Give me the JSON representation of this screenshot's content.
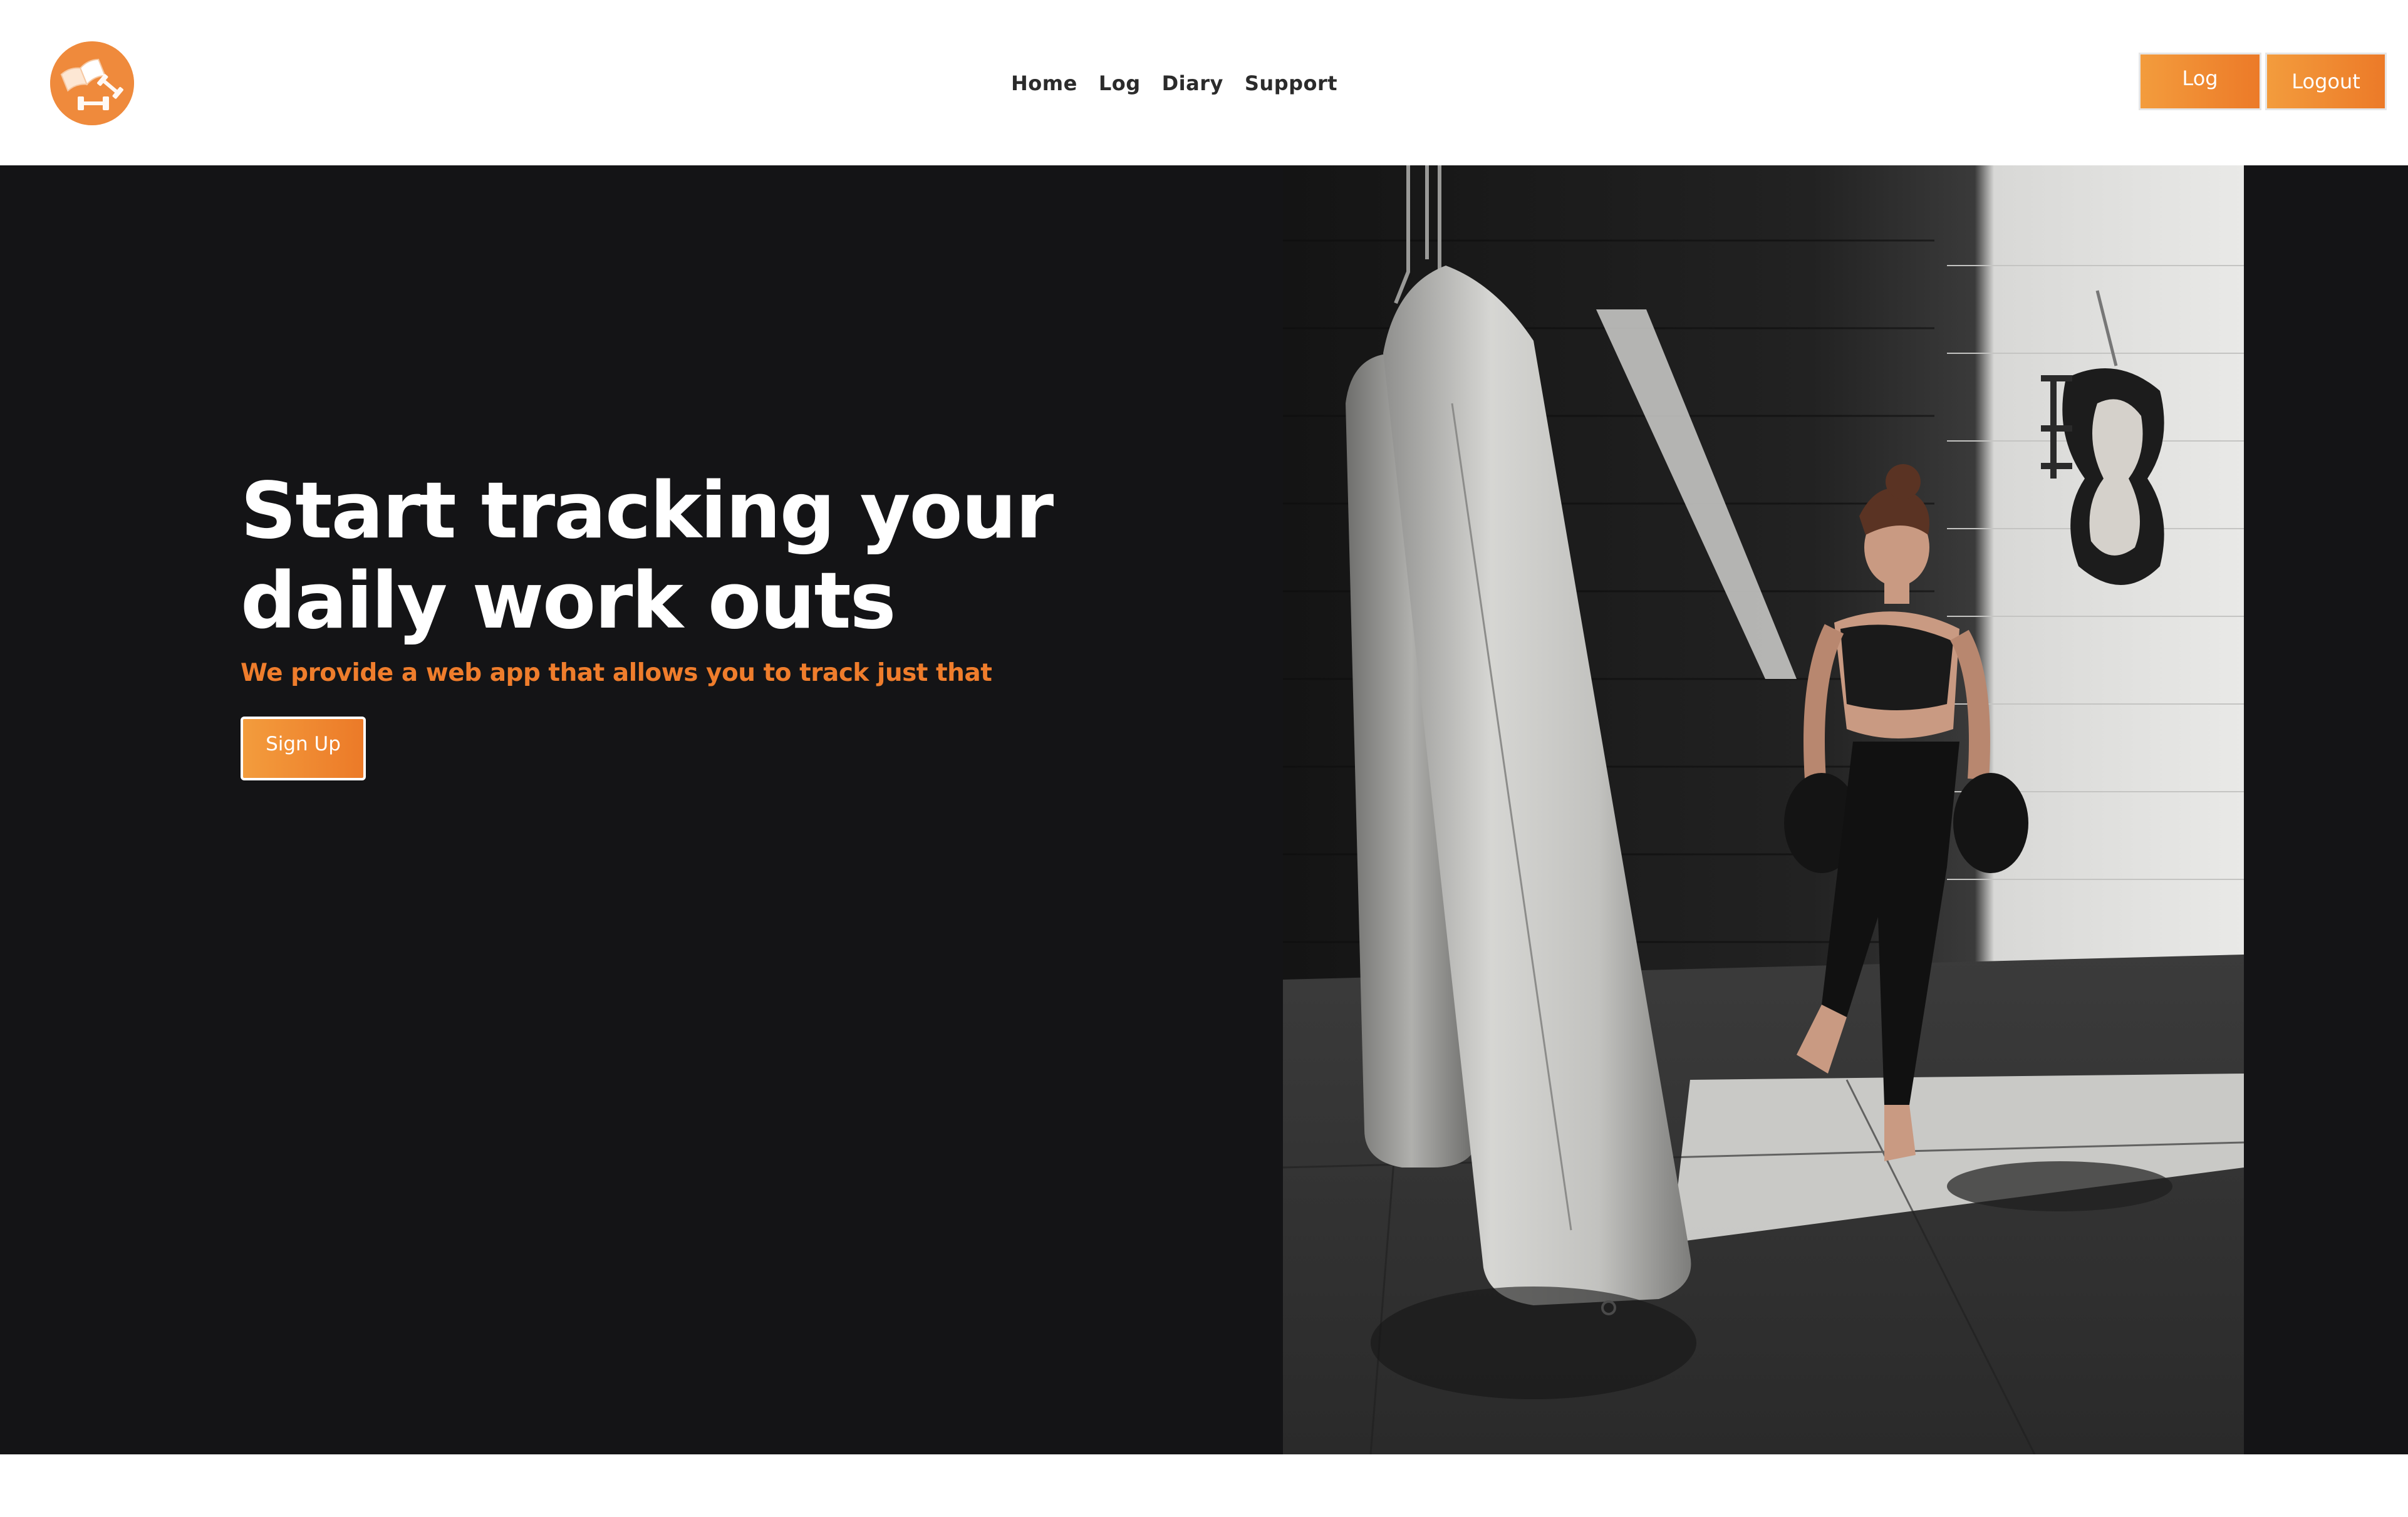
{
  "header": {
    "logo_icon": "book-and-dumbbell-icon",
    "nav": [
      "Home",
      "Log",
      "Diary",
      "Support"
    ],
    "log_button": "Log",
    "logout_button": "Logout"
  },
  "hero": {
    "headline": "Start tracking your daily work outs",
    "tagline": "We provide a web app that allows you to track just that",
    "signup_button": "Sign Up",
    "image": "boxing-gym-woman-punching-bag-photo"
  },
  "colors": {
    "accent": "#ef7d2c",
    "hero_bg": "#141416",
    "header_bg": "#ffffff"
  }
}
